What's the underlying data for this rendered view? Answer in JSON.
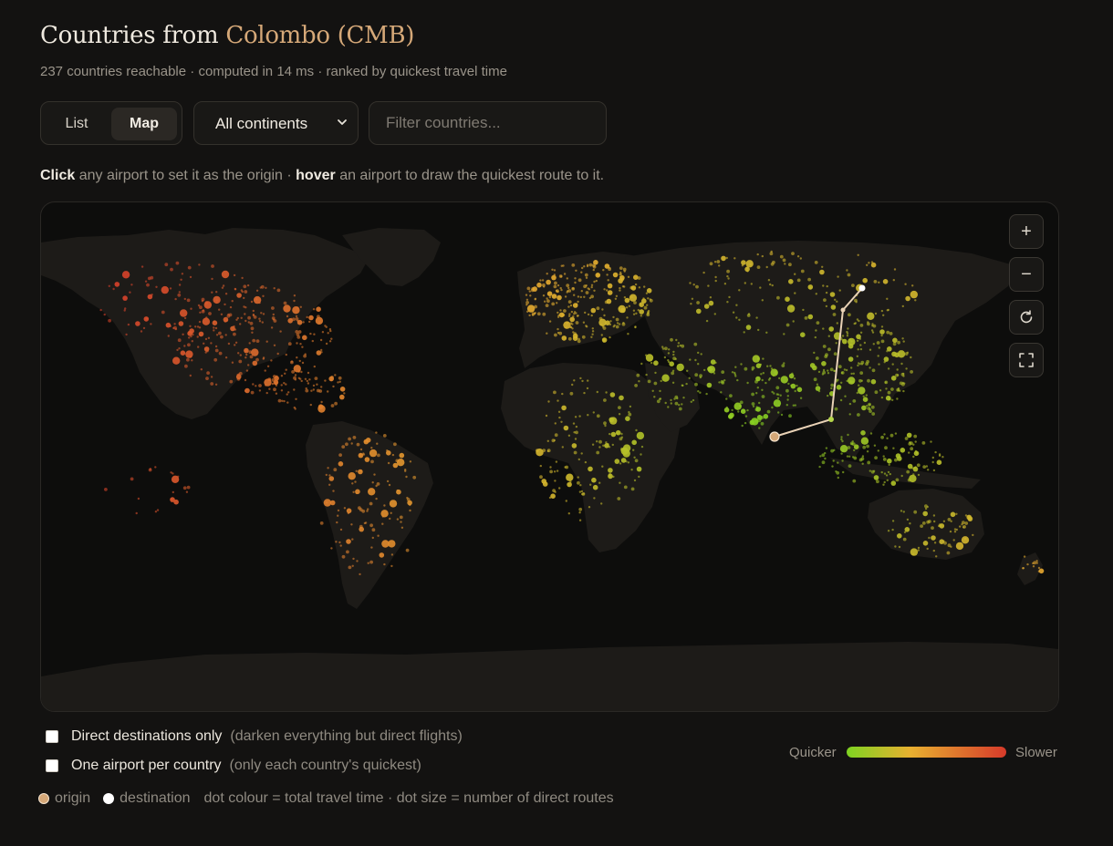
{
  "header": {
    "title_prefix": "Countries from",
    "title_origin": "Colombo (CMB)",
    "subtitle": "237 countries reachable · computed in 14 ms · ranked by quickest travel time"
  },
  "view_toggle": {
    "list_label": "List",
    "map_label": "Map",
    "selected": "Map"
  },
  "continent_select": {
    "value": "All continents",
    "icon": "chevron-down-icon"
  },
  "filter": {
    "placeholder": "Filter countries...",
    "value": ""
  },
  "hint": {
    "click_word": "Click",
    "click_text": "any airport to set it as the origin ·",
    "hover_word": "hover",
    "hover_text": "an airport to draw the quickest route to it."
  },
  "map_controls": {
    "zoom_in": "+",
    "zoom_out": "−",
    "reset_icon": "refresh-icon",
    "fullscreen_icon": "fullscreen-icon"
  },
  "options": {
    "direct_label": "Direct destinations only",
    "direct_note": "(darken everything but direct flights)",
    "direct_checked": false,
    "one_airport_label": "One airport per country",
    "one_airport_note": "(only each country's quickest)",
    "one_airport_checked": false
  },
  "legend": {
    "quicker": "Quicker",
    "slower": "Slower",
    "origin_label": "origin",
    "destination_label": "destination",
    "explanation": "dot colour = total travel time · dot size = number of direct routes"
  },
  "colors": {
    "origin": "#d5a878",
    "destination": "#ffffff",
    "quick": "#7ed321",
    "mid": "#e8b030",
    "slow": "#d63a2a",
    "land": "#1c1a17",
    "ocean": "#0d0d0c",
    "accent": "#d5a878"
  }
}
